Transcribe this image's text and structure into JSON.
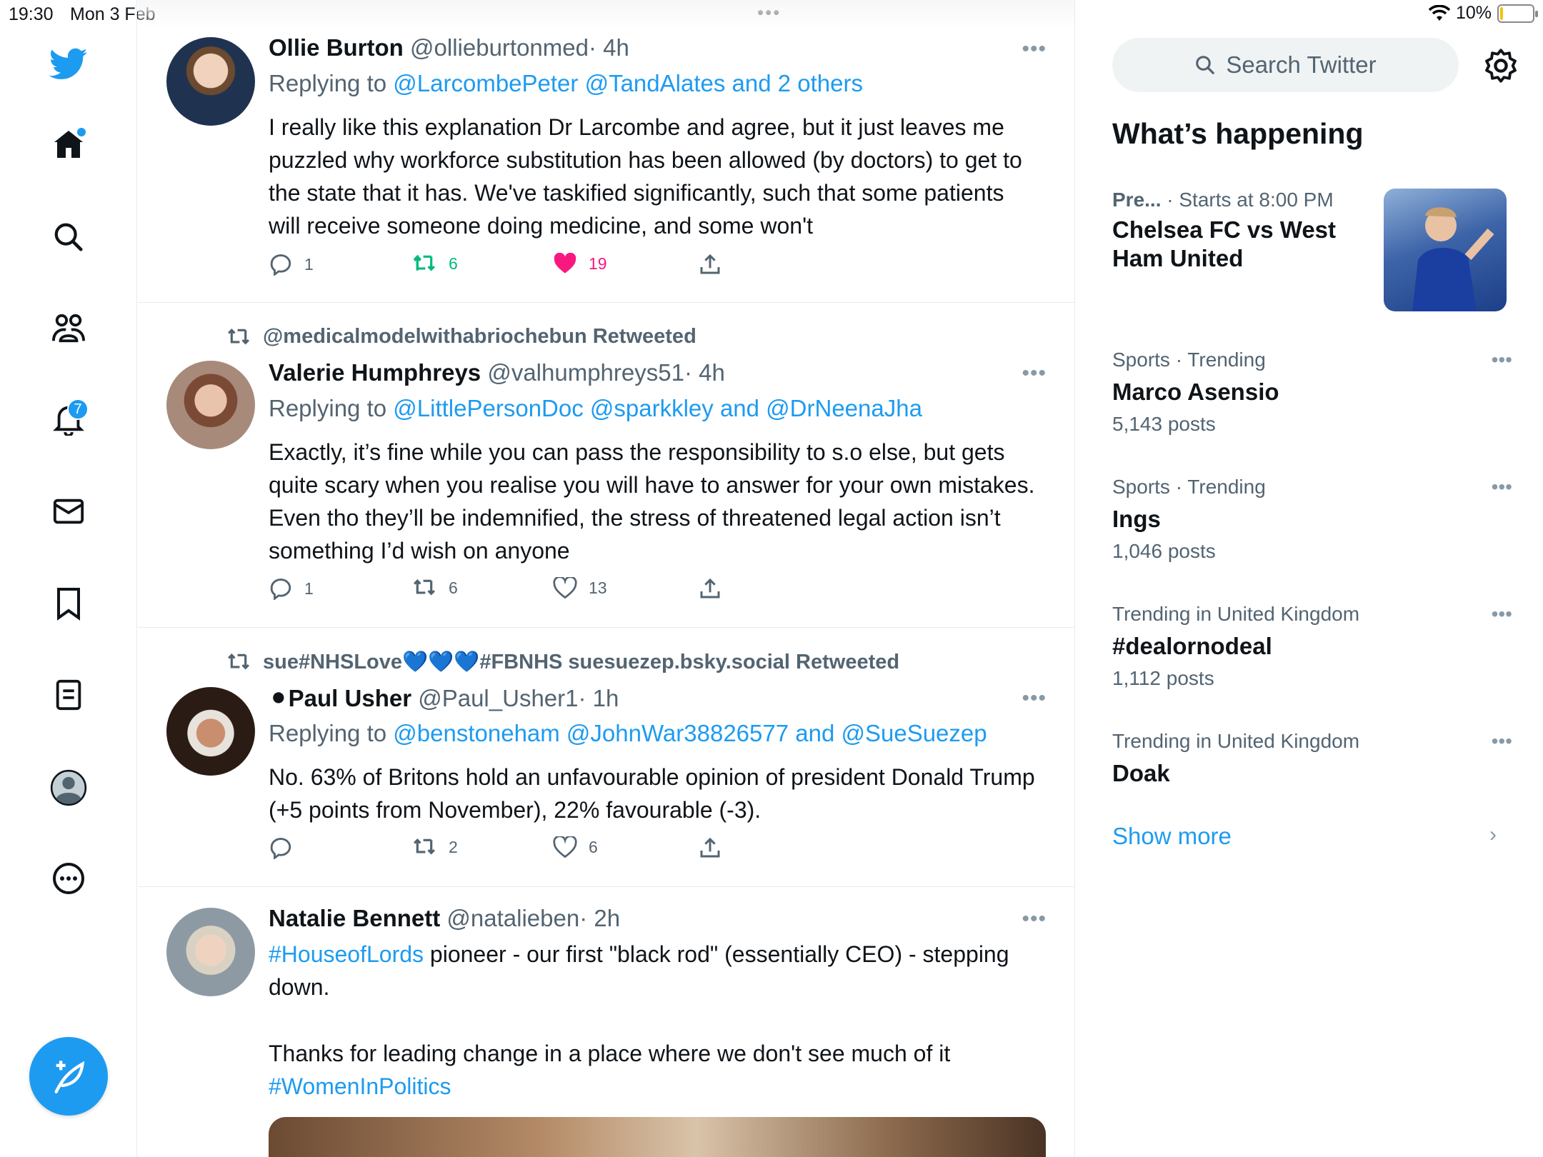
{
  "status": {
    "time": "19:30",
    "date": "Mon 3 Feb",
    "battery": "10%",
    "battery_level": 0.1
  },
  "nav": {
    "notifications_badge": "7"
  },
  "colors": {
    "accent": "#1d9bf0",
    "like": "#f91880",
    "retweet": "#00ba7c",
    "text": "#0f1419",
    "muted": "#536471"
  },
  "tweets": [
    {
      "name": "Ollie Burton",
      "handle": "@ollieburtonmed",
      "time": "· 4h",
      "reply_prefix": "Replying to",
      "reply_users": "@LarcombePeter @TandAlates and 2 others",
      "text": "I really like this explanation Dr Larcombe and agree, but it just leaves me puzzled why workforce substitution has been allowed (by doctors) to get to the state that it has. We've taskified significantly, such that some patients will receive someone doing medicine, and some won't",
      "replies": "1",
      "retweets": "6",
      "likes": "19"
    },
    {
      "retweeted_by": "@medicalmodelwithabriochebun Retweeted",
      "name": "Valerie Humphreys",
      "handle": "@valhumphreys51",
      "time": "· 4h",
      "reply_prefix": "Replying to",
      "reply_users": "@LittlePersonDoc @sparkkley and @DrNeenaJha",
      "text": "Exactly, it’s fine while you can pass the responsibility to s.o else, but gets quite scary when you realise you will have to answer for your own mistakes. Even tho they’ll be indemnified, the stress of threatened legal action isn’t something I’d wish on anyone",
      "replies": "1",
      "retweets": "6",
      "likes": "13"
    },
    {
      "retweeted_by": "sue#NHSLove💙💙💙#FBNHS suesuezep.bsky.social Retweeted",
      "name": "⚫Paul Usher",
      "handle": "@Paul_Usher1",
      "time": "· 1h",
      "reply_prefix": "Replying to",
      "reply_users": "@benstoneham @JohnWar38826577 and @SueSuezep",
      "text": "No. 63% of Britons hold an unfavourable opinion of president Donald Trump (+5 points from November), 22% favourable (-3).",
      "replies": "",
      "retweets": "2",
      "likes": "6"
    },
    {
      "name": "Natalie Bennett",
      "handle": "@natalieben",
      "time": "· 2h",
      "hashtag1": "#HouseofLords",
      "text1": " pioneer - our first \"black rod\" (essentially CEO) - stepping down.",
      "text2": "Thanks for leading change in a place where we don't see much of it",
      "hashtag2": "#WomenInPolitics"
    }
  ],
  "sidebar": {
    "search_placeholder": "Search Twitter",
    "heading": "What’s happening",
    "event": {
      "category": "Pre...",
      "time": "· Starts at 8:00 PM",
      "title": "Chelsea FC vs West Ham United"
    },
    "trends": [
      {
        "meta": "Sports · Trending",
        "title": "Marco Asensio",
        "count": "5,143 posts"
      },
      {
        "meta": "Sports · Trending",
        "title": "Ings",
        "count": "1,046 posts"
      },
      {
        "meta": "Trending in United Kingdom",
        "title": "#dealornodeal",
        "count": "1,112 posts"
      },
      {
        "meta": "Trending in United Kingdom",
        "title": "Doak",
        "count": ""
      }
    ],
    "show_more": "Show more"
  }
}
